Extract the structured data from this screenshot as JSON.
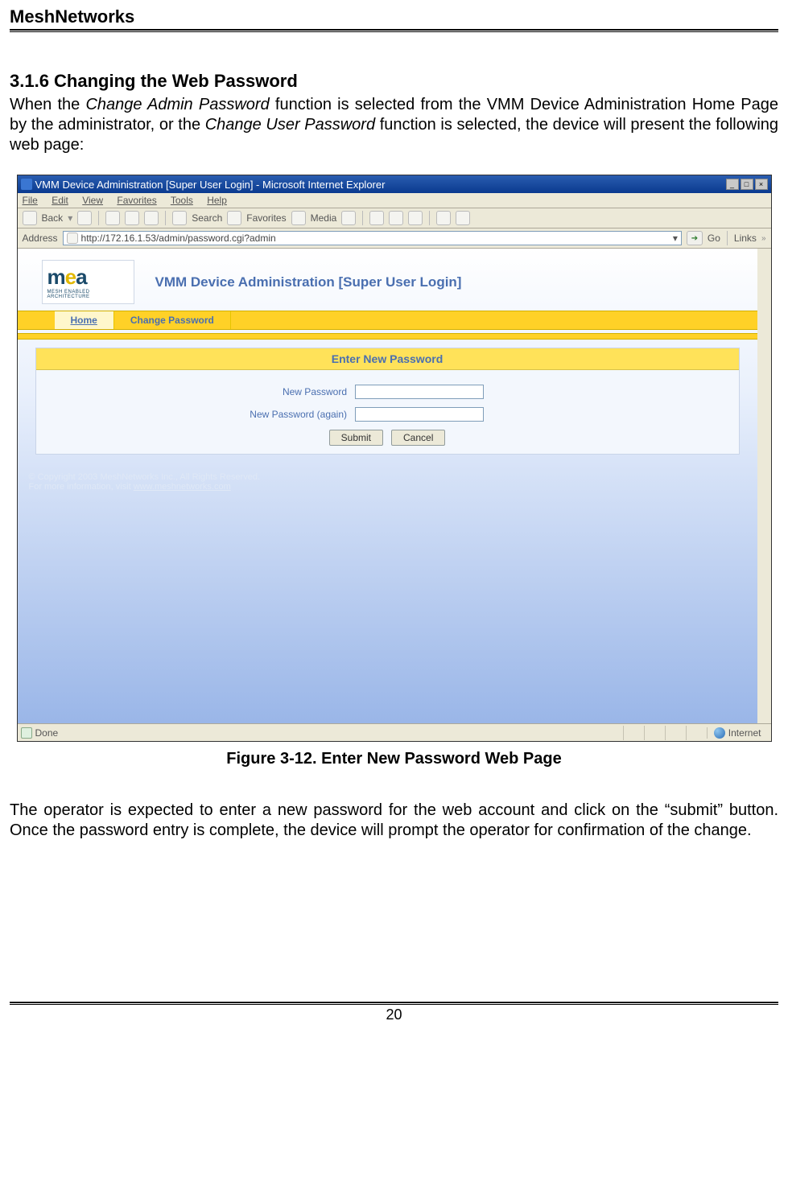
{
  "doc": {
    "header": "MeshNetworks",
    "section_heading": "3.1.6  Changing the Web Password",
    "para1_prefix": "When the ",
    "para1_italic1": "Change Admin Password",
    "para1_mid": " function is selected from the VMM Device Administration Home Page by the administrator, or the ",
    "para1_italic2": "Change User Password",
    "para1_suffix": " function is selected, the device will present the following web page:",
    "figure_caption": "Figure 3-12.    Enter New Password Web Page",
    "para2": "The operator is expected to enter a new password for the web account and click on the “submit” button. Once the password entry is complete, the device will prompt the operator for confirmation of the change.",
    "page_number": "20"
  },
  "browser": {
    "window_title": "VMM Device Administration [Super User Login] - Microsoft Internet Explorer",
    "menu": {
      "file": "File",
      "edit": "Edit",
      "view": "View",
      "favorites": "Favorites",
      "tools": "Tools",
      "help": "Help"
    },
    "toolbar": {
      "back": "Back",
      "search": "Search",
      "favorites": "Favorites",
      "media": "Media"
    },
    "address_label": "Address",
    "address_value": "http://172.16.1.53/admin/password.cgi?admin",
    "go_label": "Go",
    "links_label": "Links",
    "status_done": "Done",
    "status_zone": "Internet"
  },
  "page": {
    "logo_tag": "MESH ENABLED ARCHITECTURE",
    "title": "VMM Device Administration [Super User Login]",
    "tab_home": "Home",
    "tab_change": "Change Password",
    "form_header": "Enter New Password",
    "label_new_password": "New Password",
    "label_new_password_again": "New Password (again)",
    "btn_submit": "Submit",
    "btn_cancel": "Cancel",
    "copyright_line1": "© Copyright 2003 MeshNetworks Inc., All Rights Reserved.",
    "copyright_line2_prefix": "For more information, visit ",
    "copyright_link": "www.meshnetworks.com"
  }
}
